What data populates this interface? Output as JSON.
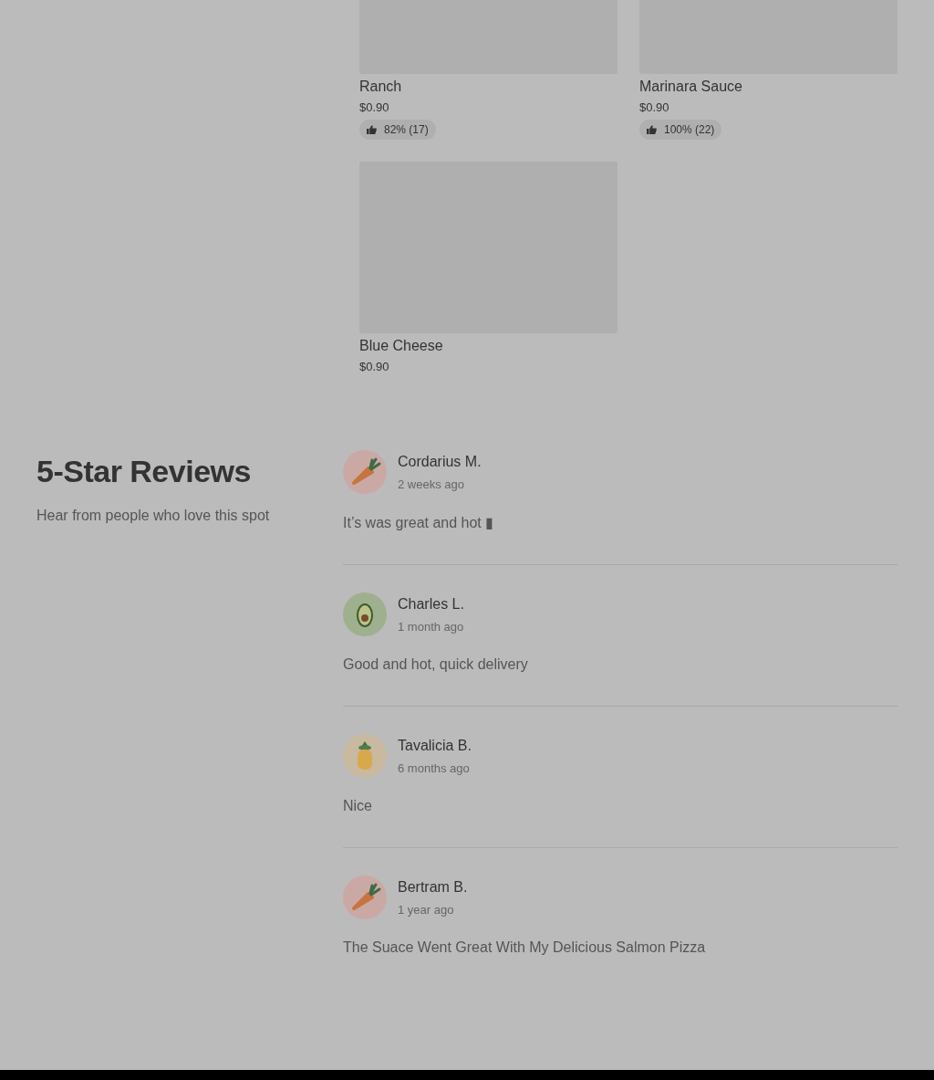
{
  "menu_items": [
    {
      "name": "Ranch",
      "price": "$0.90",
      "rating": "82% (17)"
    },
    {
      "name": "Marinara Sauce",
      "price": "$0.90",
      "rating": "100% (22)"
    },
    {
      "name": "Blue Cheese",
      "price": "$0.90"
    }
  ],
  "reviews_section": {
    "title": "5-Star Reviews",
    "subtitle": "Hear from people who love this spot",
    "reviews": [
      {
        "name": "Cordarius M.",
        "time": "2 weeks ago",
        "text": "It’s was great and hot ▮",
        "kind": "carrot"
      },
      {
        "name": "Charles L.",
        "time": "1 month ago",
        "text": "Good and hot, quick delivery",
        "kind": "avocado"
      },
      {
        "name": "Tavalicia B.",
        "time": "6 months ago",
        "text": "Nice",
        "kind": "pineapple"
      },
      {
        "name": "Bertram B.",
        "time": "1 year ago",
        "text": "The Suace Went Great With My Delicious Salmon Pizza",
        "kind": "carrot"
      }
    ]
  }
}
